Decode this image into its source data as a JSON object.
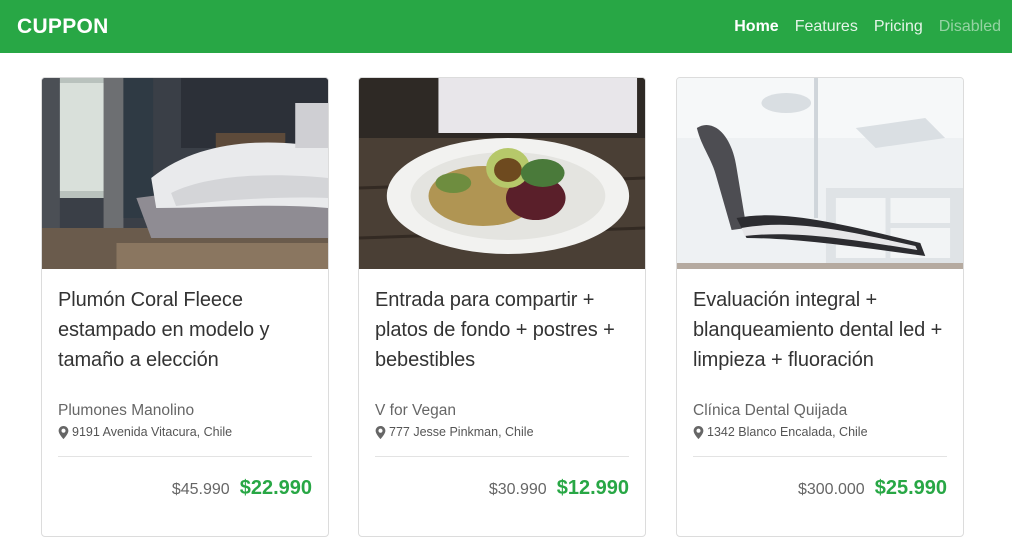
{
  "navbar": {
    "brand": "CUPPON",
    "links": [
      {
        "label": "Home"
      },
      {
        "label": "Features"
      },
      {
        "label": "Pricing"
      },
      {
        "label": "Disabled"
      }
    ]
  },
  "colors": {
    "accent": "#28a745",
    "navbar_bg": "#28a745",
    "price": "#28a745"
  },
  "deals": [
    {
      "image": "bedroom-photo",
      "title": "Plumón Coral Fleece estampado en modelo y tamaño a elección",
      "merchant": "Plumones Manolino",
      "address": "9191 Avenida Vitacura, Chile",
      "old_price": "$45.990",
      "new_price": "$22.990"
    },
    {
      "image": "salad-plate-photo",
      "title": "Entrada para compartir + platos de fondo + postres + bebestibles",
      "merchant": "V for Vegan",
      "address": "777 Jesse Pinkman, Chile",
      "old_price": "$30.990",
      "new_price": "$12.990"
    },
    {
      "image": "dental-chair-photo",
      "title": "Evaluación integral + blanqueamiento dental led + limpieza + fluoración",
      "merchant": "Clínica Dental Quijada",
      "address": "1342 Blanco Encalada, Chile",
      "old_price": "$300.000",
      "new_price": "$25.990"
    }
  ]
}
